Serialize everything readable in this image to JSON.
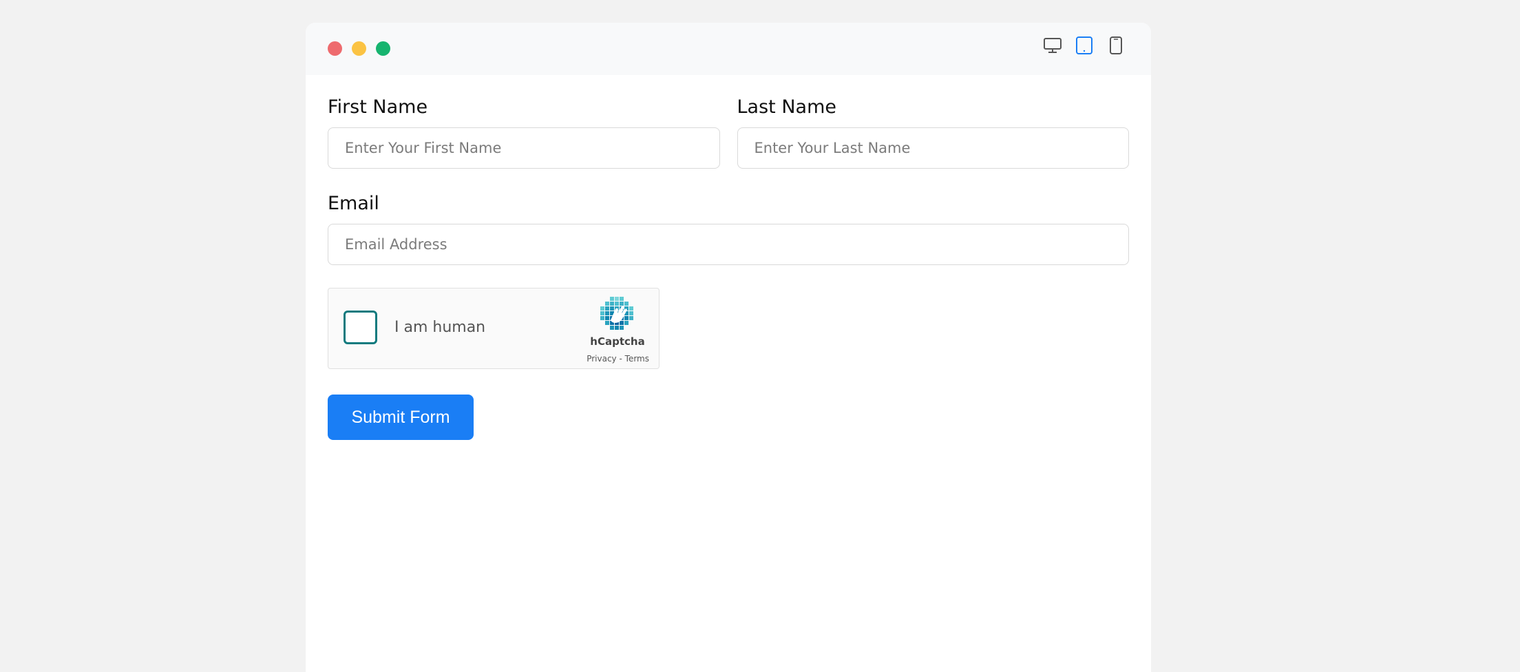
{
  "window": {
    "controls": [
      "close",
      "minimize",
      "maximize"
    ],
    "device_toggles": [
      {
        "icon": "desktop-icon",
        "active": false
      },
      {
        "icon": "tablet-icon",
        "active": true
      },
      {
        "icon": "mobile-icon",
        "active": false
      }
    ]
  },
  "form": {
    "first_name": {
      "label": "First Name",
      "placeholder": "Enter Your First Name"
    },
    "last_name": {
      "label": "Last Name",
      "placeholder": "Enter Your Last Name"
    },
    "email": {
      "label": "Email",
      "placeholder": "Email Address"
    },
    "captcha": {
      "text": "I am human",
      "brand": "hCaptcha",
      "privacy": "Privacy",
      "separator": "-",
      "terms": "Terms"
    },
    "submit_label": "Submit Form"
  },
  "colors": {
    "accent": "#1a7ef5",
    "captcha_checkbox": "#0f7a7e",
    "close": "#ee6b6e",
    "minimize": "#fbc343",
    "maximize": "#17b46f"
  }
}
